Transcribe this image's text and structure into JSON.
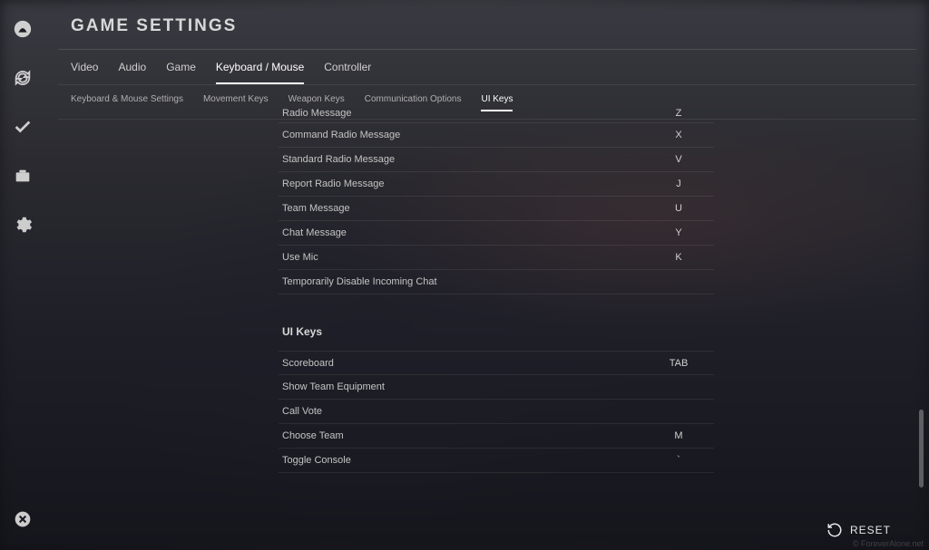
{
  "title": "GAME SETTINGS",
  "tabs": {
    "primary": [
      "Video",
      "Audio",
      "Game",
      "Keyboard / Mouse",
      "Controller"
    ],
    "primary_active": 3,
    "secondary": [
      "Keyboard & Mouse Settings",
      "Movement Keys",
      "Weapon Keys",
      "Communication Options",
      "UI Keys"
    ],
    "secondary_active": 4
  },
  "comm_rows": [
    {
      "label": "Radio Message",
      "key": "Z"
    },
    {
      "label": "Command Radio Message",
      "key": "X"
    },
    {
      "label": "Standard Radio Message",
      "key": "V"
    },
    {
      "label": "Report Radio Message",
      "key": "J"
    },
    {
      "label": "Team Message",
      "key": "U"
    },
    {
      "label": "Chat Message",
      "key": "Y"
    },
    {
      "label": "Use Mic",
      "key": "K"
    },
    {
      "label": "Temporarily Disable Incoming Chat",
      "key": ""
    }
  ],
  "ui_section_title": "UI Keys",
  "ui_rows": [
    {
      "label": "Scoreboard",
      "key": "TAB"
    },
    {
      "label": "Show Team Equipment",
      "key": ""
    },
    {
      "label": "Call Vote",
      "key": ""
    },
    {
      "label": "Choose Team",
      "key": "M"
    },
    {
      "label": "Toggle Console",
      "key": "`"
    }
  ],
  "footer": {
    "reset": "RESET"
  },
  "watermark": "© ForeverAlone.net"
}
